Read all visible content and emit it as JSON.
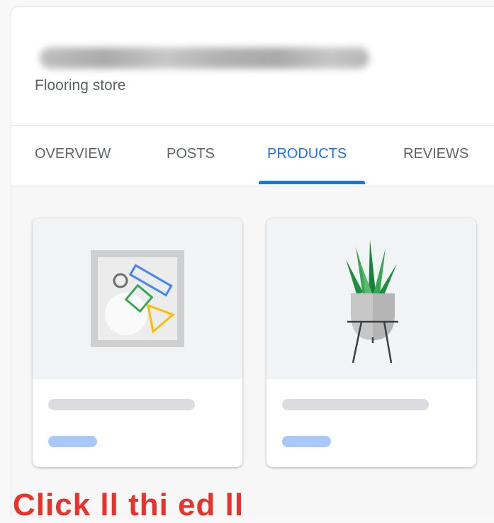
{
  "business": {
    "category": "Flooring store"
  },
  "tabs": [
    {
      "label": "OVERVIEW",
      "active": false
    },
    {
      "label": "POSTS",
      "active": false
    },
    {
      "label": "PRODUCTS",
      "active": true
    },
    {
      "label": "REVIEWS",
      "active": false
    }
  ],
  "products": [
    {
      "image_icon": "shapes-frame-icon"
    },
    {
      "image_icon": "potted-plant-icon"
    }
  ],
  "colors": {
    "accent": "#1a73e8",
    "tab_text": "#5f6368",
    "placeholder_bar": "#dadce0",
    "placeholder_price": "#a8c7fa",
    "cta": "#e8322b"
  },
  "cta": {
    "text": "Click ll    thi    ed   ll"
  }
}
